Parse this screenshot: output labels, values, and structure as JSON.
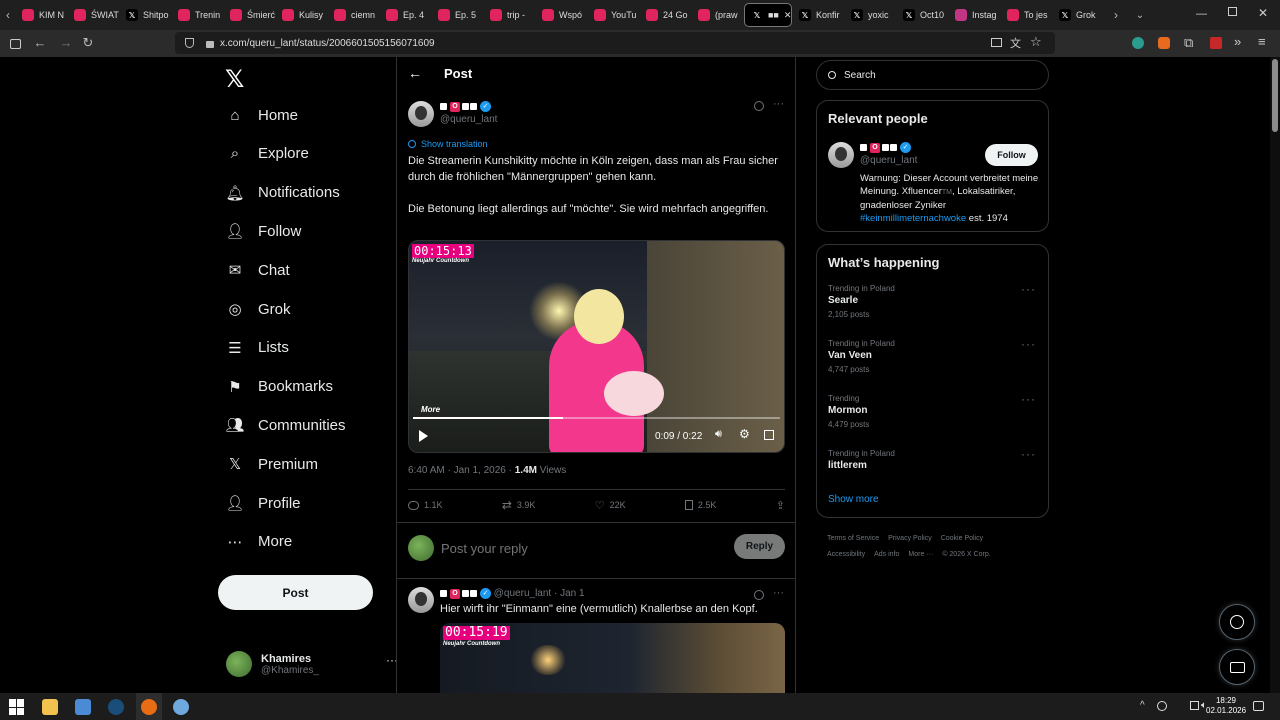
{
  "browser": {
    "tabs": [
      {
        "label": "KIM N",
        "color": "#e0245e",
        "icon": "red-app-icon"
      },
      {
        "label": "ŚWIAT",
        "color": "#e0245e",
        "icon": "red-app-icon"
      },
      {
        "label": "Shitpo",
        "color": "#000000",
        "icon": "x-logo-icon"
      },
      {
        "label": "Trenin",
        "color": "#e0245e",
        "icon": "red-app-icon"
      },
      {
        "label": "Śmierć",
        "color": "#e0245e",
        "icon": "red-app-icon"
      },
      {
        "label": "Kulisy",
        "color": "#e0245e",
        "icon": "red-app-icon"
      },
      {
        "label": "ciemn",
        "color": "#e0245e",
        "icon": "red-app-icon"
      },
      {
        "label": "Ep. 4",
        "color": "#e0245e",
        "icon": "red-app-icon"
      },
      {
        "label": "Ep. 5",
        "color": "#e0245e",
        "icon": "red-app-icon"
      },
      {
        "label": "trip -",
        "color": "#e0245e",
        "icon": "red-app-icon"
      },
      {
        "label": "Wspó",
        "color": "#e0245e",
        "icon": "red-app-icon"
      },
      {
        "label": "YouTu",
        "color": "#e0245e",
        "icon": "red-app-icon"
      },
      {
        "label": "24 Go",
        "color": "#e0245e",
        "icon": "red-app-icon"
      },
      {
        "label": "(praw",
        "color": "#e0245e",
        "icon": "red-app-icon"
      },
      {
        "label": "■■",
        "color": "#000000",
        "icon": "x-logo-icon",
        "active": true
      },
      {
        "label": "Konfir",
        "color": "#000000",
        "icon": "x-logo-icon"
      },
      {
        "label": "yoxic",
        "color": "#000000",
        "icon": "x-logo-icon"
      },
      {
        "label": "Oct10",
        "color": "#000000",
        "icon": "x-logo-icon"
      },
      {
        "label": "Instag",
        "color": "#c13584",
        "icon": "instagram-icon"
      },
      {
        "label": "To jes",
        "color": "#e0245e",
        "icon": "red-app-icon"
      },
      {
        "label": "Grok",
        "color": "#000000",
        "icon": "x-logo-icon"
      }
    ],
    "url": "x.com/queru_lant/status/2006601505156071609"
  },
  "nav": {
    "items": [
      {
        "label": "Home",
        "icon": "home-icon"
      },
      {
        "label": "Explore",
        "icon": "search-icon"
      },
      {
        "label": "Notifications",
        "icon": "bell-icon"
      },
      {
        "label": "Follow",
        "icon": "add-person-icon"
      },
      {
        "label": "Chat",
        "icon": "mail-icon"
      },
      {
        "label": "Grok",
        "icon": "grok-icon"
      },
      {
        "label": "Lists",
        "icon": "list-icon"
      },
      {
        "label": "Bookmarks",
        "icon": "bookmark-icon"
      },
      {
        "label": "Communities",
        "icon": "communities-icon"
      },
      {
        "label": "Premium",
        "icon": "x-logo-icon"
      },
      {
        "label": "Profile",
        "icon": "person-icon"
      },
      {
        "label": "More",
        "icon": "more-circle-icon"
      }
    ],
    "post_label": "Post",
    "account": {
      "name": "Khamires",
      "handle": "@Khamires_"
    }
  },
  "post": {
    "header_title": "Post",
    "handle": "@queru_lant",
    "show_translation": "Show translation",
    "text_1": "Die Streamerin Kunshikitty möchte in Köln zeigen, dass man als Frau sicher durch die fröhlichen \"Männergruppen\" gehen kann.",
    "text_2": "Die Betonung liegt allerdings auf \"möchte\". Sie wird mehrfach angegriffen.",
    "video": {
      "timer": "00:15:13",
      "overlay_caption": "Neujahr Countdown",
      "watermark": "More",
      "time": "0:09 / 0:22",
      "progress": 0.41
    },
    "meta_time": "6:40 AM · Jan 1, 2026 · ",
    "views": "1.4M",
    "views_label": " Views",
    "replies": "1.1K",
    "reposts": "3.9K",
    "likes": "22K",
    "bookmarks": "2.5K",
    "reply_placeholder": "Post your reply",
    "reply_button": "Reply"
  },
  "reply_tweet": {
    "handle": "@queru_lant",
    "date": " · Jan 1",
    "text": "Hier wirft ihr \"Einmann\" eine (vermutlich) Knallerbse an den Kopf.",
    "timer": "00:15:19",
    "overlay_caption": "Neujahr Countdown"
  },
  "sidebar": {
    "search_placeholder": "Search",
    "relevant_title": "Relevant people",
    "person_handle": "@queru_lant",
    "follow_label": "Follow",
    "bio_1": "Warnung: Dieser Account verbreitet meine Meinung. Xfluencer",
    "bio_tm": "TM",
    "bio_2": ", Lokalsatiriker, gnadenloser Zyniker",
    "bio_hashtag": "#keinmillimeternachwoke",
    "bio_3": " est. 1974",
    "happening_title": "What’s happening",
    "trends": [
      {
        "context": "Trending in Poland",
        "name": "Searle",
        "posts": "2,105 posts"
      },
      {
        "context": "Trending in Poland",
        "name": "Van Veen",
        "posts": "4,747 posts"
      },
      {
        "context": "Trending",
        "name": "Mormon",
        "posts": "4,479 posts"
      },
      {
        "context": "Trending in Poland",
        "name": "littlerem",
        "posts": ""
      }
    ],
    "show_more": "Show more",
    "footer": [
      "Terms of Service",
      "Privacy Policy",
      "Cookie Policy",
      "Accessibility",
      "Ads info",
      "More ···",
      "© 2026 X Corp."
    ]
  },
  "taskbar": {
    "time": "18:29",
    "date": "02.01.2026"
  }
}
